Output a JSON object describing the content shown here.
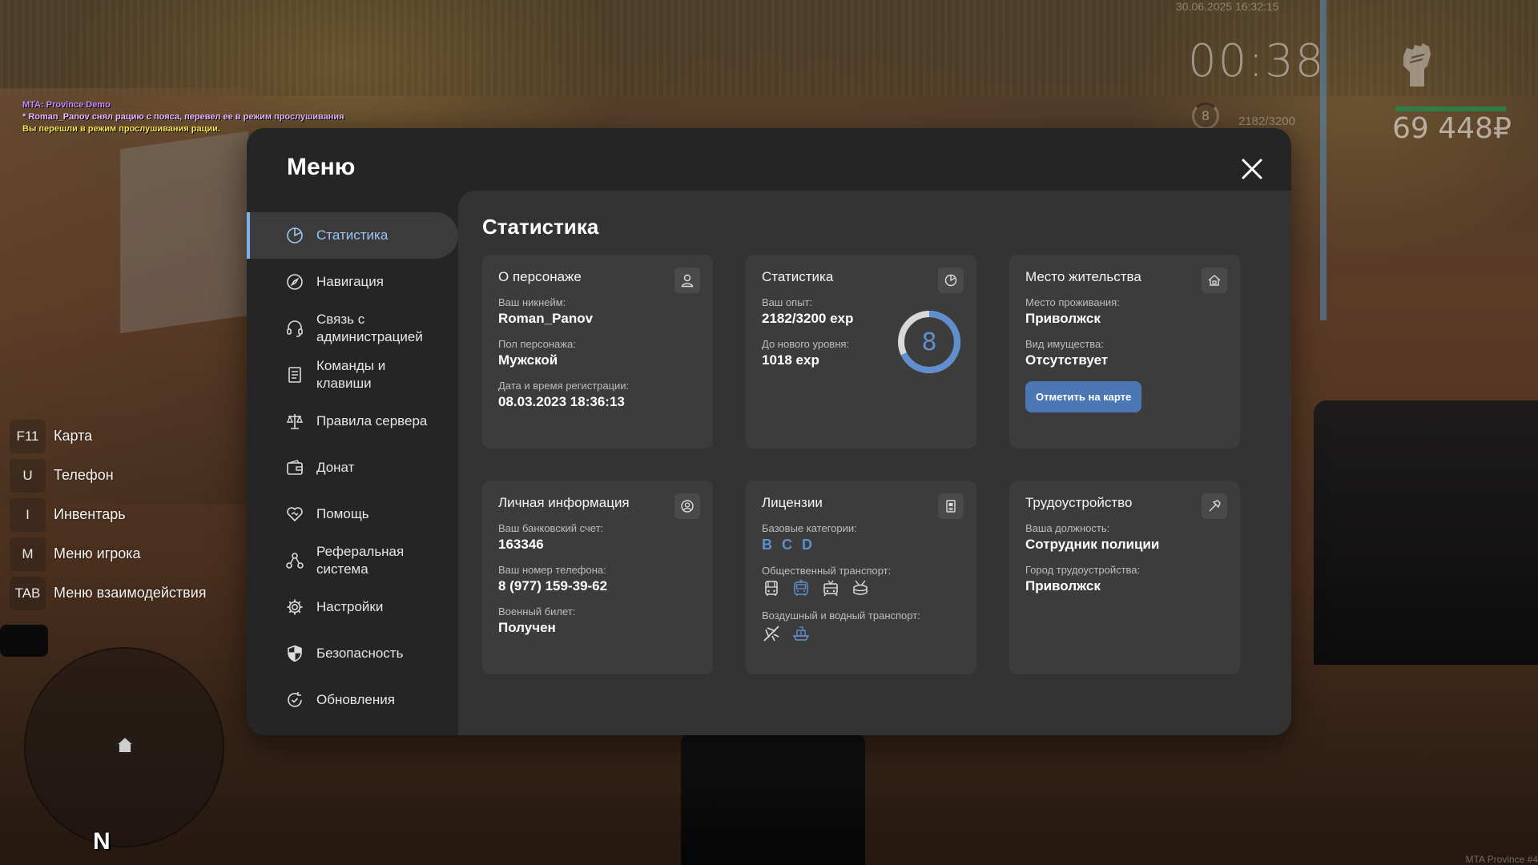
{
  "chat": {
    "line1": "MTA: Province Demo",
    "line2": "* Roman_Panov снял рацию с пояса, перевел ее в режим прослушивания",
    "line3": "Вы перешли в режим прослушивания рации."
  },
  "hud": {
    "datetime": "30.06.2025 16:32:15",
    "timer": "00:38",
    "level": "8",
    "exp": "2182/3200",
    "money": "69 448₽",
    "watermark": "MTA Province #4"
  },
  "hotkeys": [
    {
      "key": "F11",
      "label": "Карта"
    },
    {
      "key": "U",
      "label": "Телефон"
    },
    {
      "key": "I",
      "label": "Инвентарь"
    },
    {
      "key": "M",
      "label": "Меню игрока"
    },
    {
      "key": "TAB",
      "label": "Меню взаимодействия"
    }
  ],
  "minimap": {
    "north": "N"
  },
  "menu": {
    "title": "Меню",
    "nav": [
      {
        "label": "Статистика",
        "icon": "pie-chart-icon",
        "active": true
      },
      {
        "label": "Навигация",
        "icon": "compass-icon"
      },
      {
        "label": "Связь с\nадминистрацией",
        "icon": "headset-icon"
      },
      {
        "label": "Команды и\nклавиши",
        "icon": "document-icon"
      },
      {
        "label": "Правила сервера",
        "icon": "scales-icon"
      },
      {
        "label": "Донат",
        "icon": "wallet-icon"
      },
      {
        "label": "Помощь",
        "icon": "handshake-icon"
      },
      {
        "label": "Реферальная\nсистема",
        "icon": "network-icon"
      },
      {
        "label": "Настройки",
        "icon": "gear-icon"
      },
      {
        "label": "Безопасность",
        "icon": "shield-icon"
      },
      {
        "label": "Обновления",
        "icon": "refresh-icon"
      }
    ]
  },
  "stats": {
    "title": "Статистика",
    "character": {
      "title": "О персонаже",
      "nickname_label": "Ваш никнейм:",
      "nickname": "Roman_Panov",
      "gender_label": "Пол персонажа:",
      "gender": "Мужской",
      "reg_label": "Дата и время регистрации:",
      "reg": "08.03.2023 18:36:13"
    },
    "statistics": {
      "title": "Статистика",
      "exp_label": "Ваш опыт:",
      "exp": "2182/3200 exp",
      "next_label": "До нового уровня:",
      "next": "1018 exp",
      "level": "8",
      "progress": 0.68
    },
    "residence": {
      "title": "Место жительства",
      "place_label": "Место проживания:",
      "place": "Приволжск",
      "property_label": "Вид имущества:",
      "property": "Отсутствует",
      "button": "Отметить на карте"
    },
    "personal": {
      "title": "Личная информация",
      "bank_label": "Ваш банковский счет:",
      "bank": "163346",
      "phone_label": "Ваш номер телефона:",
      "phone": "8 (977) 159-39-62",
      "military_label": "Военный билет:",
      "military": "Получен"
    },
    "licenses": {
      "title": "Лицензии",
      "basic_label": "Базовые категории:",
      "basic": [
        "B",
        "C",
        "D"
      ],
      "public_label": "Общественный транспорт:",
      "public_icons": [
        "bus-icon",
        "bus-front-icon",
        "tram-icon",
        "trolleybus-icon"
      ],
      "air_label": "Воздушный и водный транспорт:",
      "air_icons": [
        "plane-icon",
        "ship-icon"
      ]
    },
    "employment": {
      "title": "Трудоустройство",
      "position_label": "Ваша должность:",
      "position": "Сотрудник полиции",
      "city_label": "Город трудоустройства:",
      "city": "Приволжск"
    }
  },
  "colors": {
    "accent": "#5f8fcf",
    "button": "#4b77b5",
    "panel": "#252525",
    "content": "#333333",
    "card": "#3c3c3c"
  }
}
